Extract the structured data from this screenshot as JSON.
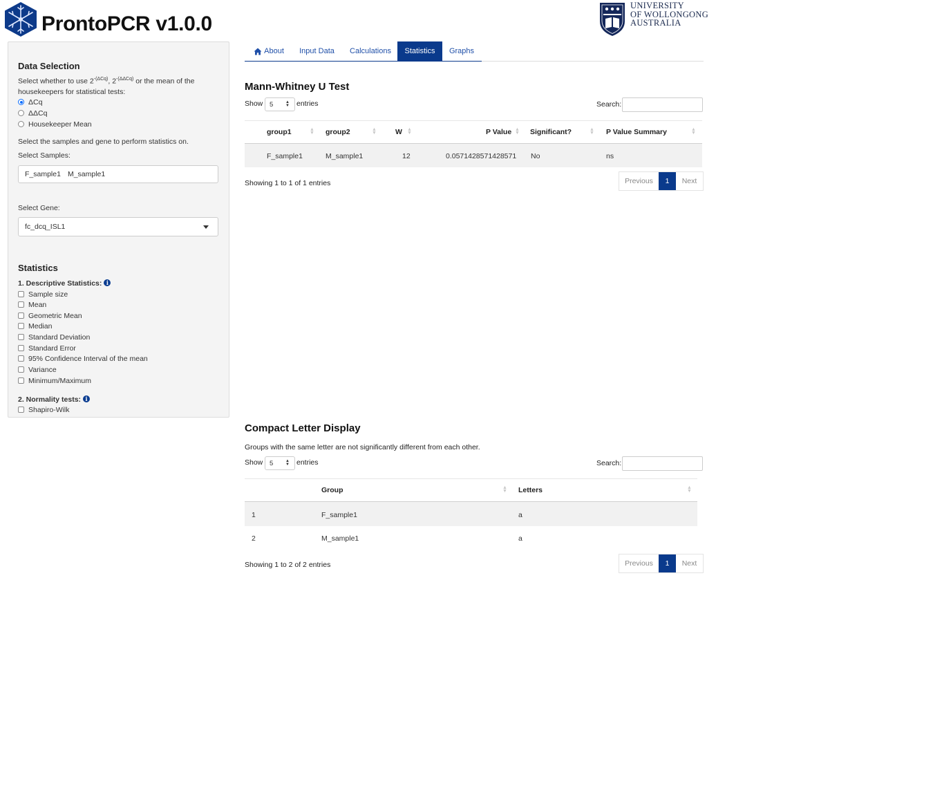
{
  "header": {
    "app_title": "ProntoPCR v1.0.0",
    "university_lines": [
      "UNIVERSITY",
      "OF WOLLONGONG",
      "AUSTRALIA"
    ]
  },
  "sidebar": {
    "data_selection_heading": "Data Selection",
    "select_whether_pre": "Select whether to use 2",
    "sup_dcq": "-(ΔCq)",
    "sep": ", 2",
    "sup_ddcq": "-(ΔΔCq)",
    "select_whether_post": " or the mean of the",
    "select_whether_line2": "housekeepers for statistical tests:",
    "radio_options": [
      "ΔCq",
      "ΔΔCq",
      "Housekeeper Mean"
    ],
    "selected_radio": "ΔCq",
    "select_samples_gene_text": "Select the samples and gene to perform statistics on.",
    "select_samples_label": "Select Samples:",
    "selected_samples": [
      "F_sample1",
      "M_sample1"
    ],
    "select_gene_label": "Select Gene:",
    "selected_gene": "fc_dcq_ISL1",
    "statistics_heading": "Statistics",
    "descriptive_label": "1. Descriptive Statistics:",
    "descriptive_options": [
      "Sample size",
      "Mean",
      "Geometric Mean",
      "Median",
      "Standard Deviation",
      "Standard Error",
      "95% Confidence Interval of the mean",
      "Variance",
      "Minimum/Maximum"
    ],
    "normality_label": "2. Normality tests:",
    "normality_options": [
      "Shapiro-Wilk"
    ]
  },
  "tabs": {
    "items": [
      "About",
      "Input Data",
      "Calculations",
      "Statistics",
      "Graphs"
    ],
    "active": "Statistics"
  },
  "mann_whitney": {
    "title": "Mann-Whitney U Test",
    "show_label": "Show",
    "entries_value": "5",
    "entries_label": "entries",
    "search_label": "Search:",
    "columns": [
      "group1",
      "group2",
      "W",
      "P Value",
      "Significant?",
      "P Value Summary"
    ],
    "rows": [
      [
        "F_sample1",
        "M_sample1",
        "12",
        "0.0571428571428571",
        "No",
        "ns"
      ]
    ],
    "info": "Showing 1 to 1 of 1 entries",
    "pagination": {
      "previous": "Previous",
      "page": "1",
      "next": "Next"
    }
  },
  "cld": {
    "title": "Compact Letter Display",
    "description": "Groups with the same letter are not significantly different from each other.",
    "show_label": "Show",
    "entries_value": "5",
    "entries_label": "entries",
    "search_label": "Search:",
    "columns": [
      "",
      "Group",
      "Letters"
    ],
    "rows": [
      [
        "1",
        "F_sample1",
        "a"
      ],
      [
        "2",
        "M_sample1",
        "a"
      ]
    ],
    "info": "Showing 1 to 2 of 2 entries",
    "pagination": {
      "previous": "Previous",
      "page": "1",
      "next": "Next"
    }
  }
}
